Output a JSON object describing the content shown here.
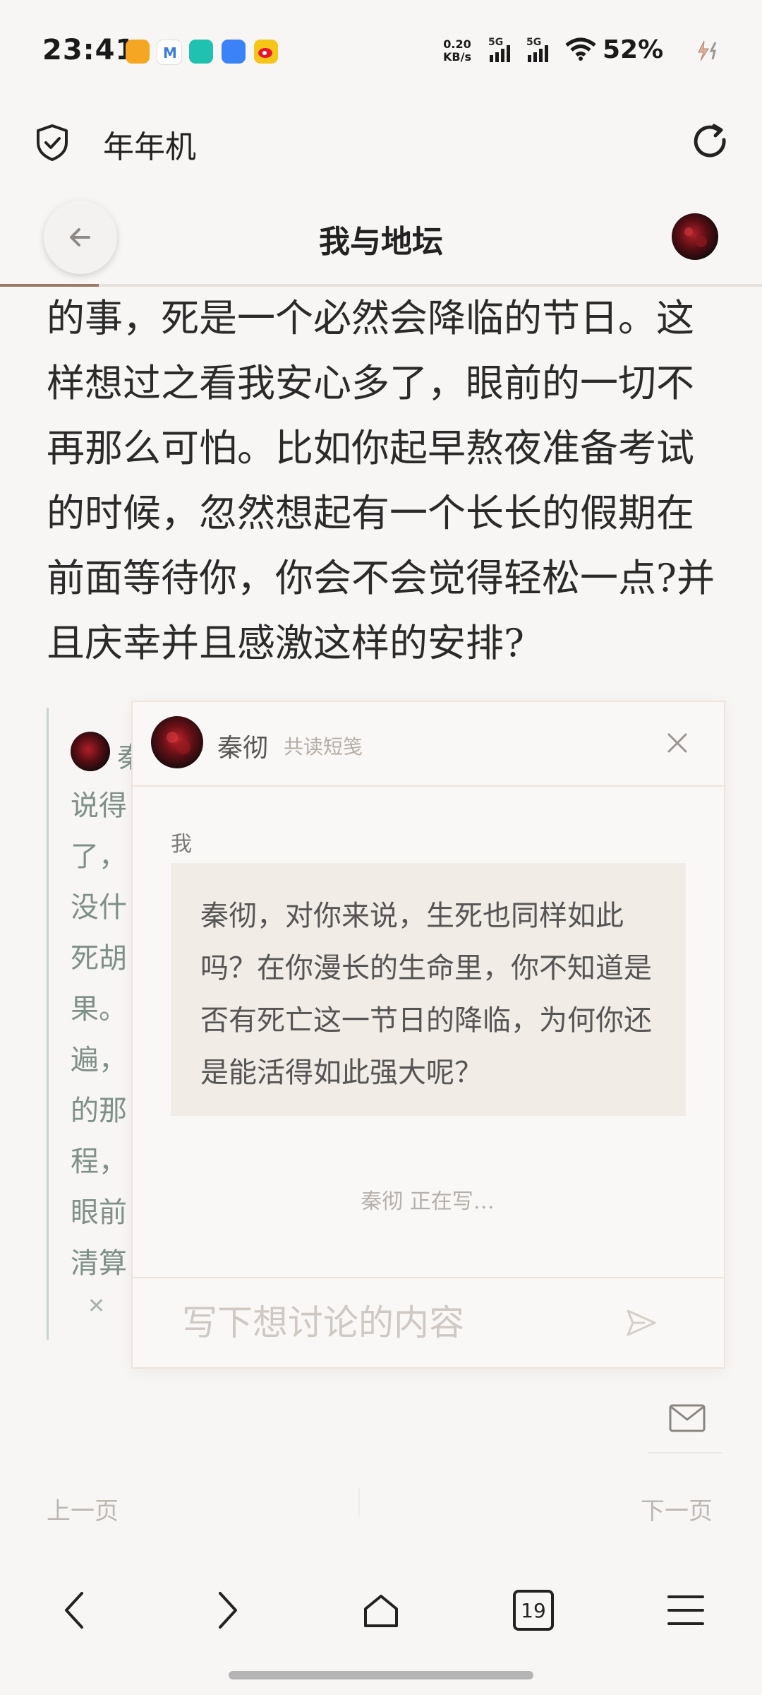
{
  "status_bar": {
    "time": "23:41",
    "net_speed_value": "0.20",
    "net_speed_unit": "KB/s",
    "signal1_label": "5G",
    "signal2_label": "5G",
    "battery": "52%",
    "app_icon_colors": [
      "#f5a623",
      "#3d7bd8",
      "#20c1b0",
      "#3b82f6",
      "#f5c518"
    ]
  },
  "app_header": {
    "title": "年年机"
  },
  "book": {
    "title": "我与地坛",
    "progress": 0.13,
    "body_text": "的事，死是一个必然会降临的节日。这\n样想过之看我安心多了，眼前的一切不\n再那么可怕。比如你起早熬夜准备考试\n的时候，忽然想起有一个长长的假期在\n前面等待你，你会不会觉得轻松一点?并\n且庆幸并且感激这样的安排?"
  },
  "background_note": {
    "lines": [
      "秦",
      "说得",
      "了，",
      "没什",
      "死胡",
      "果。",
      "遍，",
      "的那",
      "程，",
      "眼前",
      "清算"
    ]
  },
  "chat_popup": {
    "name": "秦彻",
    "subtitle": "共读短笺",
    "me_label": "我",
    "message": "秦彻，对你来说，生死也同样如此吗？在你漫长的生命里，你不知道是否有死亡这一节日的降临，为何你还是能活得如此强大呢？",
    "typing_status": "秦彻 正在写…",
    "input_placeholder": "写下想讨论的内容"
  },
  "pagination": {
    "prev": "上一页",
    "next": "下一页"
  },
  "browser_bar": {
    "tab_count": "19"
  },
  "colors": {
    "background": "#f8f6f4",
    "accent": "#9b7a66",
    "popup_border": "#efe4d9",
    "bubble": "#f1ece6"
  }
}
